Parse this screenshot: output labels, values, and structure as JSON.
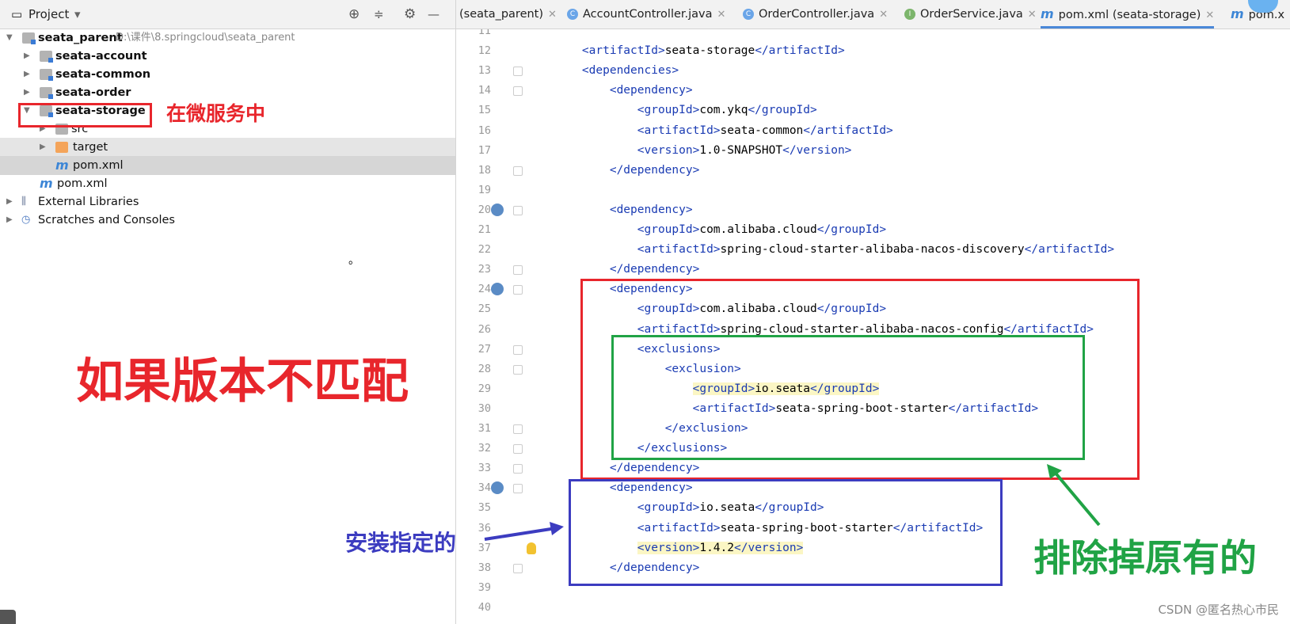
{
  "project_bar": {
    "title": "Project",
    "dropdown": "▾"
  },
  "tree": [
    {
      "label": "seata_parent",
      "path": "D:\\课件\\8.springcloud\\seata_parent"
    },
    {
      "label": "seata-account"
    },
    {
      "label": "seata-common"
    },
    {
      "label": "seata-order"
    },
    {
      "label": "seata-storage"
    },
    {
      "label": "src"
    },
    {
      "label": "target"
    },
    {
      "label": "pom.xml"
    },
    {
      "label": "pom.xml"
    },
    {
      "label": "External Libraries"
    },
    {
      "label": "Scratches and Consoles"
    }
  ],
  "tabs": [
    {
      "label": "(seata_parent)"
    },
    {
      "label": "AccountController.java"
    },
    {
      "label": "OrderController.java"
    },
    {
      "label": "OrderService.java"
    },
    {
      "label": "pom.xml (seata-storage)"
    },
    {
      "label": "pom.x"
    }
  ],
  "code": [
    {
      "n": "11",
      "t": ""
    },
    {
      "n": "12",
      "t": "    <artifactId>seata-storage</artifactId>"
    },
    {
      "n": "13",
      "t": "    <dependencies>"
    },
    {
      "n": "14",
      "t": "        <dependency>"
    },
    {
      "n": "15",
      "t": "            <groupId>com.ykq</groupId>"
    },
    {
      "n": "16",
      "t": "            <artifactId>seata-common</artifactId>"
    },
    {
      "n": "17",
      "t": "            <version>1.0-SNAPSHOT</version>"
    },
    {
      "n": "18",
      "t": "        </dependency>"
    },
    {
      "n": "19",
      "t": ""
    },
    {
      "n": "20",
      "t": "        <dependency>"
    },
    {
      "n": "21",
      "t": "            <groupId>com.alibaba.cloud</groupId>"
    },
    {
      "n": "22",
      "t": "            <artifactId>spring-cloud-starter-alibaba-nacos-discovery</artifactId>"
    },
    {
      "n": "23",
      "t": "        </dependency>"
    },
    {
      "n": "24",
      "t": "        <dependency>"
    },
    {
      "n": "25",
      "t": "            <groupId>com.alibaba.cloud</groupId>"
    },
    {
      "n": "26",
      "t": "            <artifactId>spring-cloud-starter-alibaba-nacos-config</artifactId>"
    },
    {
      "n": "27",
      "t": "            <exclusions>"
    },
    {
      "n": "28",
      "t": "                <exclusion>"
    },
    {
      "n": "29",
      "t": "                    <groupId>io.seata</groupId>"
    },
    {
      "n": "30",
      "t": "                    <artifactId>seata-spring-boot-starter</artifactId>"
    },
    {
      "n": "31",
      "t": "                </exclusion>"
    },
    {
      "n": "32",
      "t": "            </exclusions>"
    },
    {
      "n": "33",
      "t": "        </dependency>"
    },
    {
      "n": "34",
      "t": "        <dependency>"
    },
    {
      "n": "35",
      "t": "            <groupId>io.seata</groupId>"
    },
    {
      "n": "36",
      "t": "            <artifactId>seata-spring-boot-starter</artifactId>"
    },
    {
      "n": "37",
      "t": "            <version>1.4.2</version>"
    },
    {
      "n": "38",
      "t": "        </dependency>"
    },
    {
      "n": "39",
      "t": ""
    },
    {
      "n": "40",
      "t": ""
    }
  ],
  "annotations": {
    "in_microservice": "在微服务中",
    "version_mismatch": "如果版本不匹配",
    "install_specified": "安装指定的",
    "exclude_original": "排除掉原有的",
    "red": "#e8262c",
    "green": "#20a345",
    "blue": "#3c3cc0"
  },
  "watermark": "CSDN @匿名热心市民",
  "stray_mark": "。"
}
